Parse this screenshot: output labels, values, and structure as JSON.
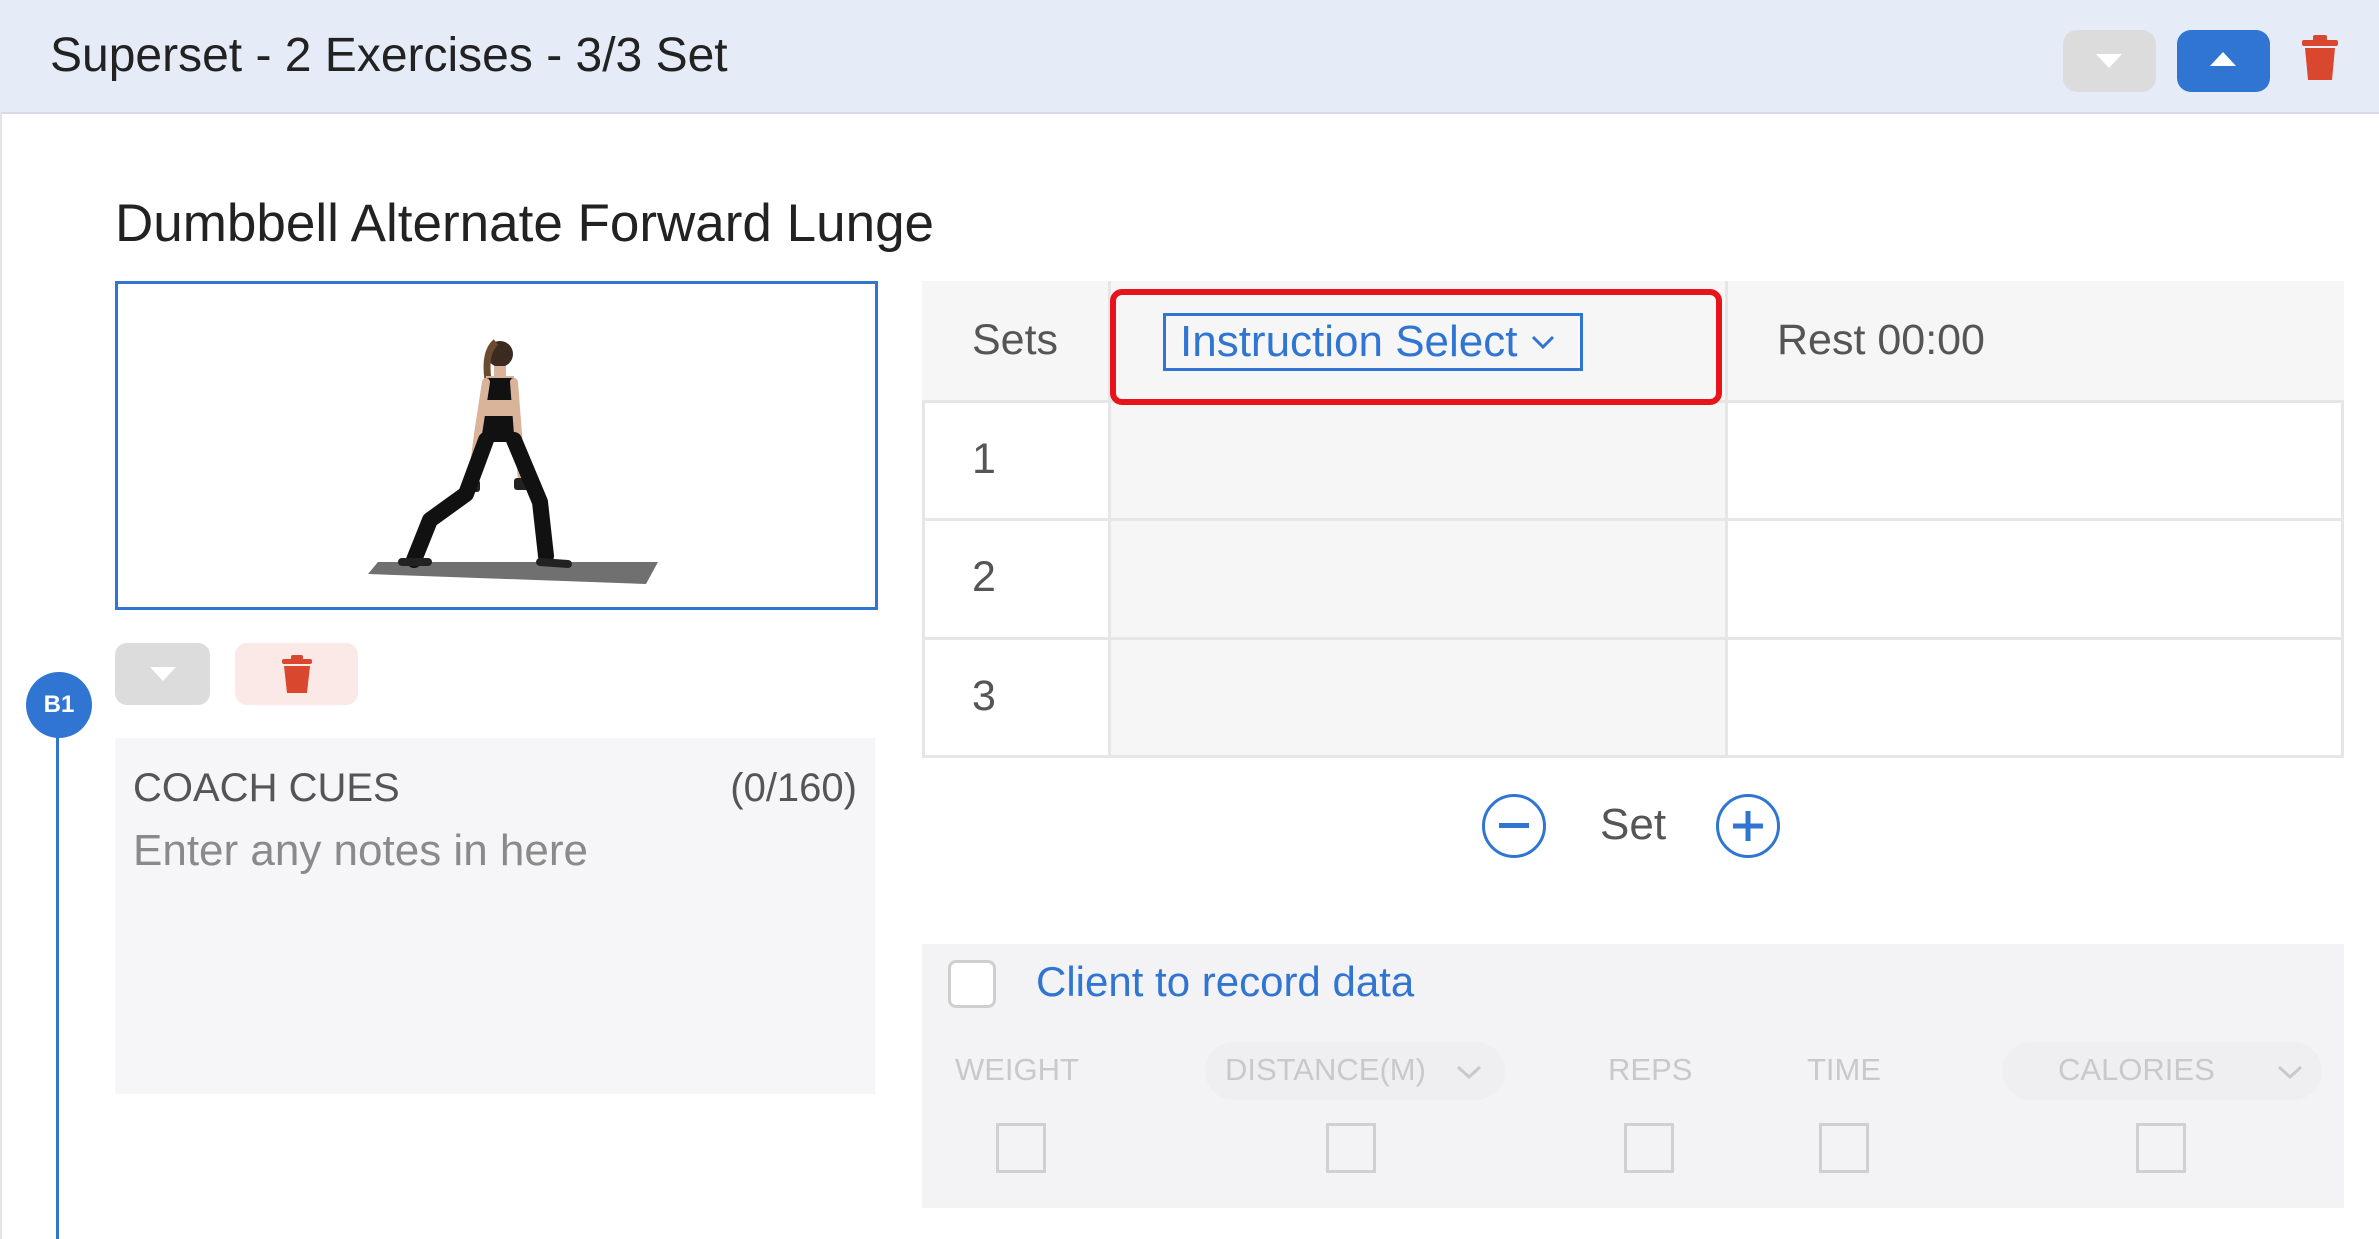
{
  "header": {
    "title": "Superset - 2 Exercises - 3/3 Set"
  },
  "exercise": {
    "title": "Dumbbell Alternate Forward Lunge",
    "badge": "B1"
  },
  "coach_cues": {
    "label": "COACH CUES",
    "count": "(0/160)",
    "placeholder": "Enter any notes in here"
  },
  "sets_table": {
    "col_sets": "Sets",
    "instruction_select": "Instruction Select",
    "col_rest": "Rest 00:00",
    "rows": [
      "1",
      "2",
      "3"
    ]
  },
  "set_controls": {
    "label": "Set"
  },
  "record": {
    "label": "Client to record data",
    "metrics": [
      "WEIGHT",
      "DISTANCE(M)",
      "REPS",
      "TIME",
      "CALORIES"
    ]
  },
  "colors": {
    "accent": "#2f75d1",
    "danger": "#d9472f",
    "highlight": "#e8141b"
  }
}
